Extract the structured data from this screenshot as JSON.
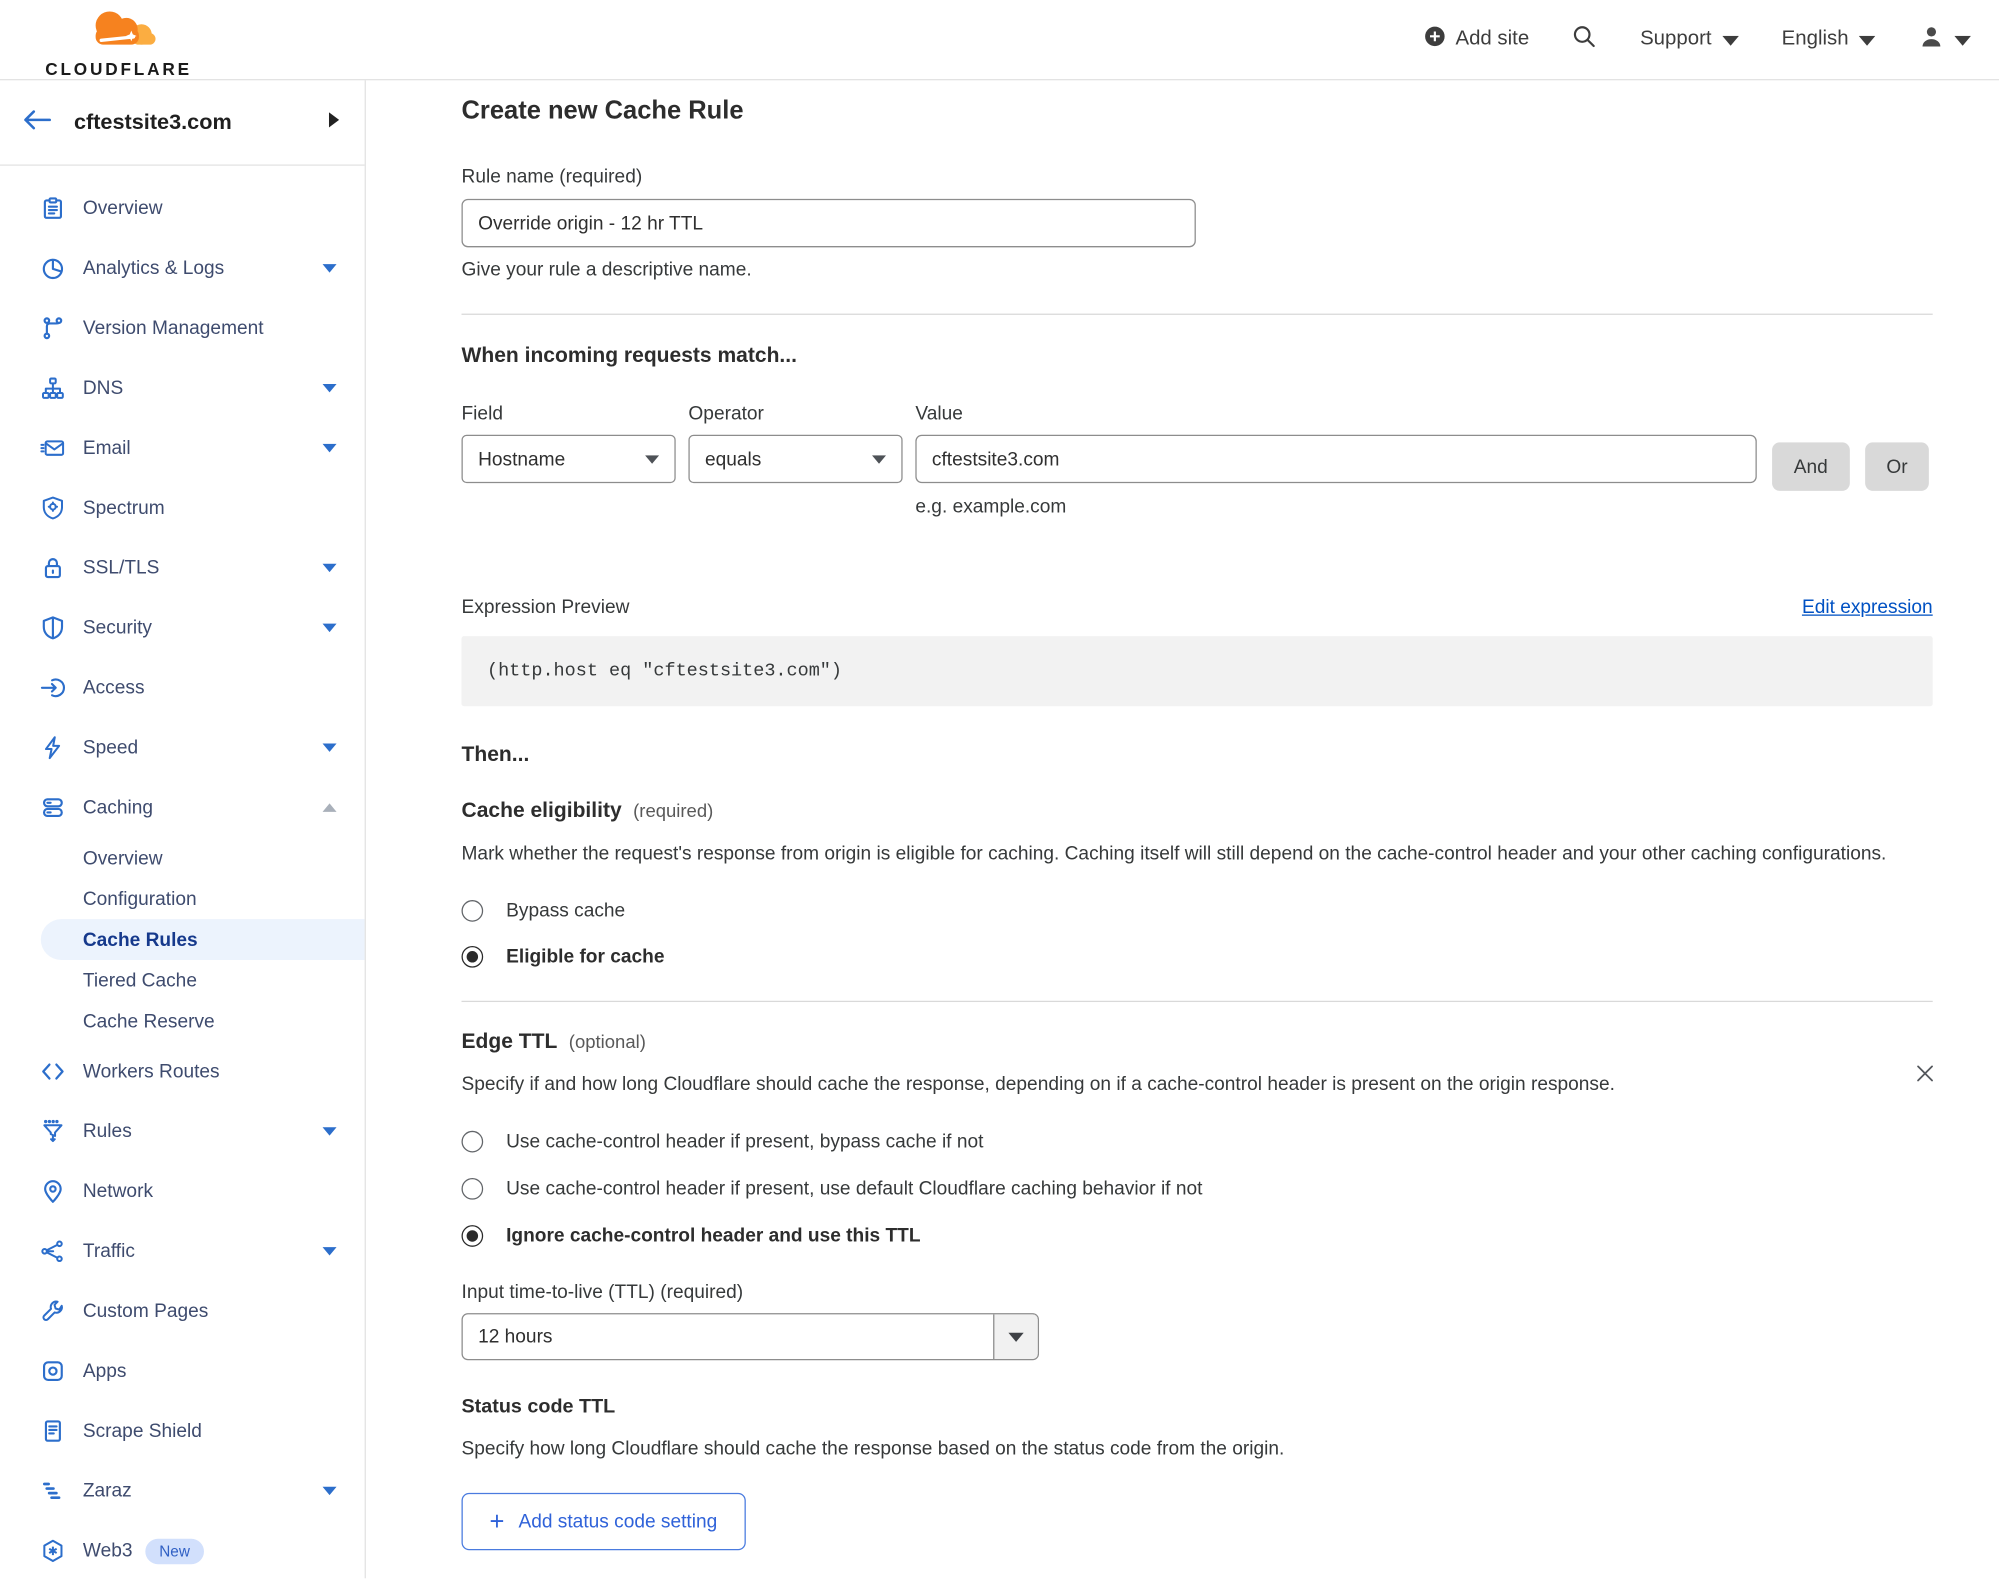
{
  "colors": {
    "accent_blue": "#0051c3",
    "icon_blue": "#2c6ecb",
    "brand_orange": "#f6821f",
    "brand_orange_light": "#fbad41",
    "active_item_bg": "#ecf3fd",
    "active_item_text": "#16398c"
  },
  "topbar": {
    "logo": "CLOUDFLARE",
    "add_site": "Add site",
    "support": "Support",
    "language": "English"
  },
  "sidebar": {
    "site": "cftestsite3.com",
    "items": [
      {
        "label": "Overview",
        "icon": "overview-icon"
      },
      {
        "label": "Analytics & Logs",
        "icon": "analytics-icon",
        "chevron": "down"
      },
      {
        "label": "Version Management",
        "icon": "version-management-icon"
      },
      {
        "label": "DNS",
        "icon": "dns-icon",
        "chevron": "down"
      },
      {
        "label": "Email",
        "icon": "email-icon",
        "chevron": "down"
      },
      {
        "label": "Spectrum",
        "icon": "spectrum-icon"
      },
      {
        "label": "SSL/TLS",
        "icon": "ssl-tls-icon",
        "chevron": "down"
      },
      {
        "label": "Security",
        "icon": "security-icon",
        "chevron": "down"
      },
      {
        "label": "Access",
        "icon": "access-icon"
      },
      {
        "label": "Speed",
        "icon": "speed-icon",
        "chevron": "down"
      },
      {
        "label": "Caching",
        "icon": "caching-icon",
        "chevron": "up",
        "expanded": true,
        "children": [
          {
            "label": "Overview",
            "active": false
          },
          {
            "label": "Configuration",
            "active": false
          },
          {
            "label": "Cache Rules",
            "active": true
          },
          {
            "label": "Tiered Cache",
            "active": false
          },
          {
            "label": "Cache Reserve",
            "active": false
          }
        ]
      },
      {
        "label": "Workers Routes",
        "icon": "workers-routes-icon"
      },
      {
        "label": "Rules",
        "icon": "rules-icon",
        "chevron": "down"
      },
      {
        "label": "Network",
        "icon": "network-icon"
      },
      {
        "label": "Traffic",
        "icon": "traffic-icon",
        "chevron": "down"
      },
      {
        "label": "Custom Pages",
        "icon": "custom-pages-icon"
      },
      {
        "label": "Apps",
        "icon": "apps-icon"
      },
      {
        "label": "Scrape Shield",
        "icon": "scrape-shield-icon"
      },
      {
        "label": "Zaraz",
        "icon": "zaraz-icon",
        "chevron": "down"
      },
      {
        "label": "Web3",
        "icon": "web3-icon",
        "badge": "New"
      }
    ]
  },
  "main": {
    "title": "Create new Cache Rule",
    "rule_name": {
      "label": "Rule name (required)",
      "value": "Override origin - 12 hr TTL",
      "helper": "Give your rule a descriptive name."
    },
    "match": {
      "heading": "When incoming requests match...",
      "field_label": "Field",
      "field_value": "Hostname",
      "operator_label": "Operator",
      "operator_value": "equals",
      "value_label": "Value",
      "value": "cftestsite3.com",
      "value_example": "e.g. example.com",
      "and_label": "And",
      "or_label": "Or"
    },
    "expression": {
      "label": "Expression Preview",
      "edit_link": "Edit expression",
      "code": "(http.host eq \"cftestsite3.com\")"
    },
    "then_heading": "Then...",
    "eligibility": {
      "heading": "Cache eligibility",
      "required_tag": "(required)",
      "description": "Mark whether the request's response from origin is eligible for caching. Caching itself will still depend on the cache-control header and your other caching configurations.",
      "options": [
        {
          "label": "Bypass cache",
          "selected": false
        },
        {
          "label": "Eligible for cache",
          "selected": true
        }
      ]
    },
    "edge_ttl": {
      "heading": "Edge TTL",
      "optional_tag": "(optional)",
      "description": "Specify if and how long Cloudflare should cache the response, depending on if a cache-control header is present on the origin response.",
      "options": [
        {
          "label": "Use cache-control header if present, bypass cache if not",
          "selected": false
        },
        {
          "label": "Use cache-control header if present, use default Cloudflare caching behavior if not",
          "selected": false
        },
        {
          "label": "Ignore cache-control header and use this TTL",
          "selected": true
        }
      ],
      "ttl_label": "Input time-to-live (TTL) (required)",
      "ttl_value": "12 hours",
      "status_heading": "Status code TTL",
      "status_description": "Specify how long Cloudflare should cache the response based on the status code from the origin.",
      "add_button": "Add status code setting"
    }
  }
}
